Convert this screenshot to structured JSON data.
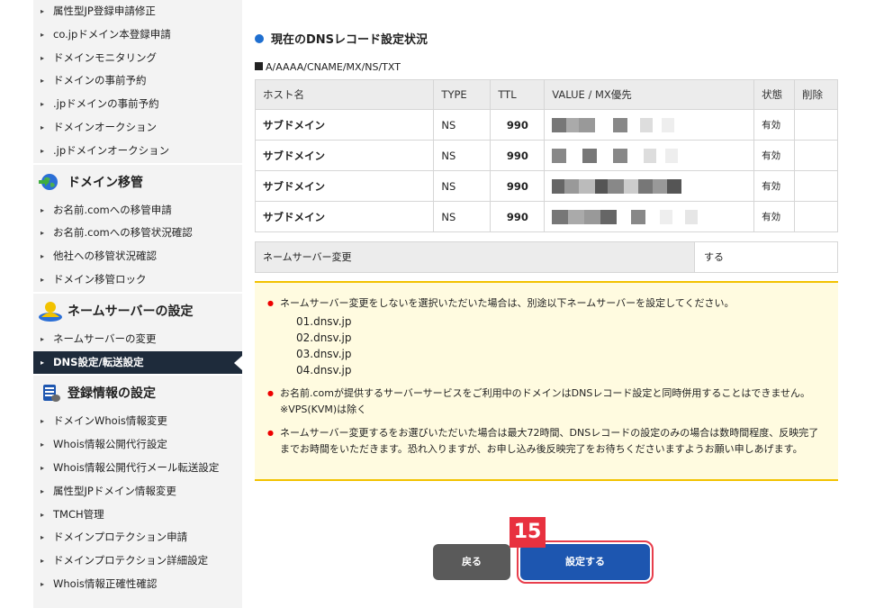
{
  "sidebar": {
    "group1": [
      "属性型JP登録申請修正",
      "co.jpドメイン本登録申請",
      "ドメインモニタリング",
      "ドメインの事前予約",
      ".jpドメインの事前予約",
      "ドメインオークション",
      ".jpドメインオークション"
    ],
    "group2_title": "ドメイン移管",
    "group2": [
      "お名前.comへの移管申請",
      "お名前.comへの移管状況確認",
      "他社への移管状況確認",
      "ドメイン移管ロック"
    ],
    "group3_title": "ネームサーバーの設定",
    "group3": [
      "ネームサーバーの変更",
      "DNS設定/転送設定"
    ],
    "group4_title": "登録情報の設定",
    "group4": [
      "ドメインWhois情報変更",
      "Whois情報公開代行設定",
      "Whois情報公開代行メール転送設定",
      "属性型JPドメイン情報変更",
      "TMCH管理",
      "ドメインプロテクション申請",
      "ドメインプロテクション詳細設定",
      "Whois情報正確性確認"
    ]
  },
  "main": {
    "section_title": "現在のDNSレコード設定状況",
    "record_types": "A/AAAA/CNAME/MX/NS/TXT",
    "table": {
      "headers": [
        "ホスト名",
        "TYPE",
        "TTL",
        "VALUE / MX優先",
        "状態",
        "削除"
      ],
      "rows": [
        {
          "host": "サブドメイン",
          "type": "NS",
          "ttl": "990",
          "status": "有効"
        },
        {
          "host": "サブドメイン",
          "type": "NS",
          "ttl": "990",
          "status": "有効"
        },
        {
          "host": "サブドメイン",
          "type": "NS",
          "ttl": "990",
          "status": "有効"
        },
        {
          "host": "サブドメイン",
          "type": "NS",
          "ttl": "990",
          "status": "有効"
        }
      ]
    },
    "ns_change": {
      "label": "ネームサーバー変更",
      "value": "する"
    },
    "notice": {
      "item1": "ネームサーバー変更をしないを選択いただいた場合は、別途以下ネームサーバーを設定してください。",
      "servers": [
        "01.dnsv.jp",
        "02.dnsv.jp",
        "03.dnsv.jp",
        "04.dnsv.jp"
      ],
      "item2_line1": "お名前.comが提供するサーバーサービスをご利用中のドメインはDNSレコード設定と同時併用することはできません。",
      "item2_line2": "※VPS(KVM)は除く",
      "item3": "ネームサーバー変更するをお選びいただいた場合は最大72時間、DNSレコードの設定のみの場合は数時間程度、反映完了までお時間をいただきます。恐れ入りますが、お申し込み後反映完了をお待ちくださいますようお願い申しあげます。"
    },
    "buttons": {
      "back": "戻る",
      "submit": "設定する"
    },
    "step_badge": "15"
  }
}
